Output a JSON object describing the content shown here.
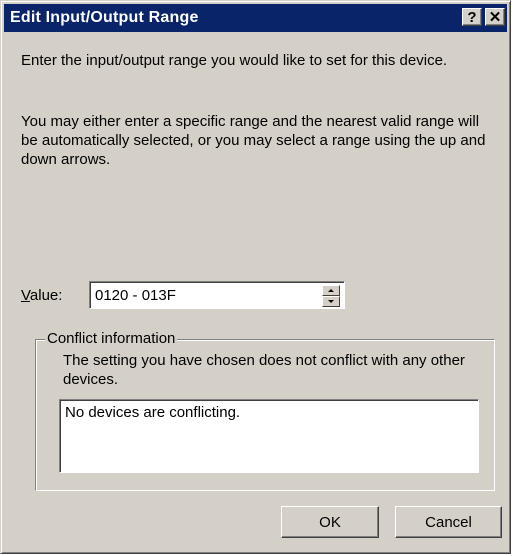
{
  "window": {
    "title": "Edit Input/Output Range",
    "help_button": "?",
    "close_button": "✕"
  },
  "instructions": {
    "line1": "Enter the input/output range you would like to set for this device.",
    "line2": "You may either enter a specific range and the nearest valid range will be automatically selected, or you may select a range using the up and down arrows."
  },
  "value_field": {
    "label_accel": "V",
    "label_rest": "alue:",
    "value": "0120 - 013F"
  },
  "conflict": {
    "legend": "Conflict information",
    "description": "The setting you have chosen does not conflict with any other devices.",
    "list_text": "No devices are conflicting."
  },
  "buttons": {
    "ok": "OK",
    "cancel": "Cancel"
  }
}
